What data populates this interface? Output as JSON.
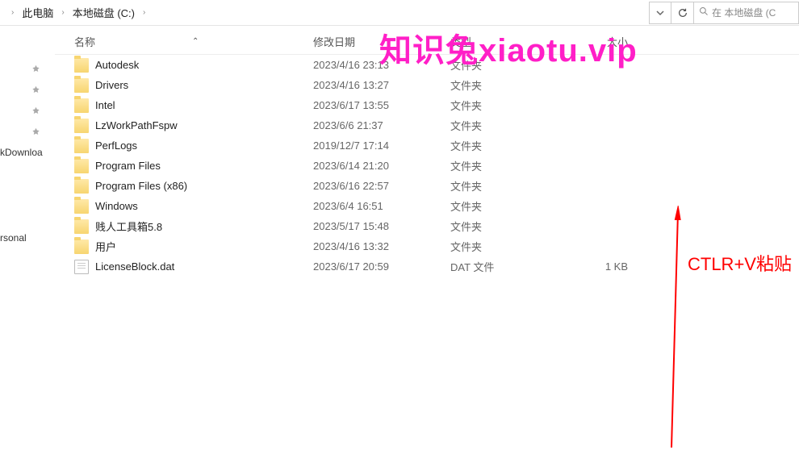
{
  "breadcrumb": {
    "items": [
      {
        "label": "此电脑"
      },
      {
        "label": "本地磁盘 (C:)"
      }
    ],
    "separator": "›"
  },
  "search": {
    "placeholder": "在 本地磁盘 (C"
  },
  "columns": {
    "name": "名称",
    "date": "修改日期",
    "type": "类型",
    "size": "大小"
  },
  "sort_indicator": "⌃",
  "sidebar": {
    "items": [
      {
        "label": "kDownloa"
      },
      {
        "label": "rsonal"
      }
    ]
  },
  "files": [
    {
      "icon": "folder",
      "name": "Autodesk",
      "date": "2023/4/16 23:13",
      "type": "文件夹",
      "size": ""
    },
    {
      "icon": "folder",
      "name": "Drivers",
      "date": "2023/4/16 13:27",
      "type": "文件夹",
      "size": ""
    },
    {
      "icon": "folder",
      "name": "Intel",
      "date": "2023/6/17 13:55",
      "type": "文件夹",
      "size": ""
    },
    {
      "icon": "folder",
      "name": "LzWorkPathFspw",
      "date": "2023/6/6 21:37",
      "type": "文件夹",
      "size": ""
    },
    {
      "icon": "folder",
      "name": "PerfLogs",
      "date": "2019/12/7 17:14",
      "type": "文件夹",
      "size": ""
    },
    {
      "icon": "folder",
      "name": "Program Files",
      "date": "2023/6/14 21:20",
      "type": "文件夹",
      "size": ""
    },
    {
      "icon": "folder",
      "name": "Program Files (x86)",
      "date": "2023/6/16 22:57",
      "type": "文件夹",
      "size": ""
    },
    {
      "icon": "folder",
      "name": "Windows",
      "date": "2023/6/4 16:51",
      "type": "文件夹",
      "size": ""
    },
    {
      "icon": "folder",
      "name": "贱人工具箱5.8",
      "date": "2023/5/17 15:48",
      "type": "文件夹",
      "size": ""
    },
    {
      "icon": "folder",
      "name": "用户",
      "date": "2023/4/16 13:32",
      "type": "文件夹",
      "size": ""
    },
    {
      "icon": "file",
      "name": "LicenseBlock.dat",
      "date": "2023/6/17 20:59",
      "type": "DAT 文件",
      "size": "1 KB"
    }
  ],
  "watermark": "知识兔xiaotu.vip",
  "annotation_text": "CTLR+V粘贴"
}
